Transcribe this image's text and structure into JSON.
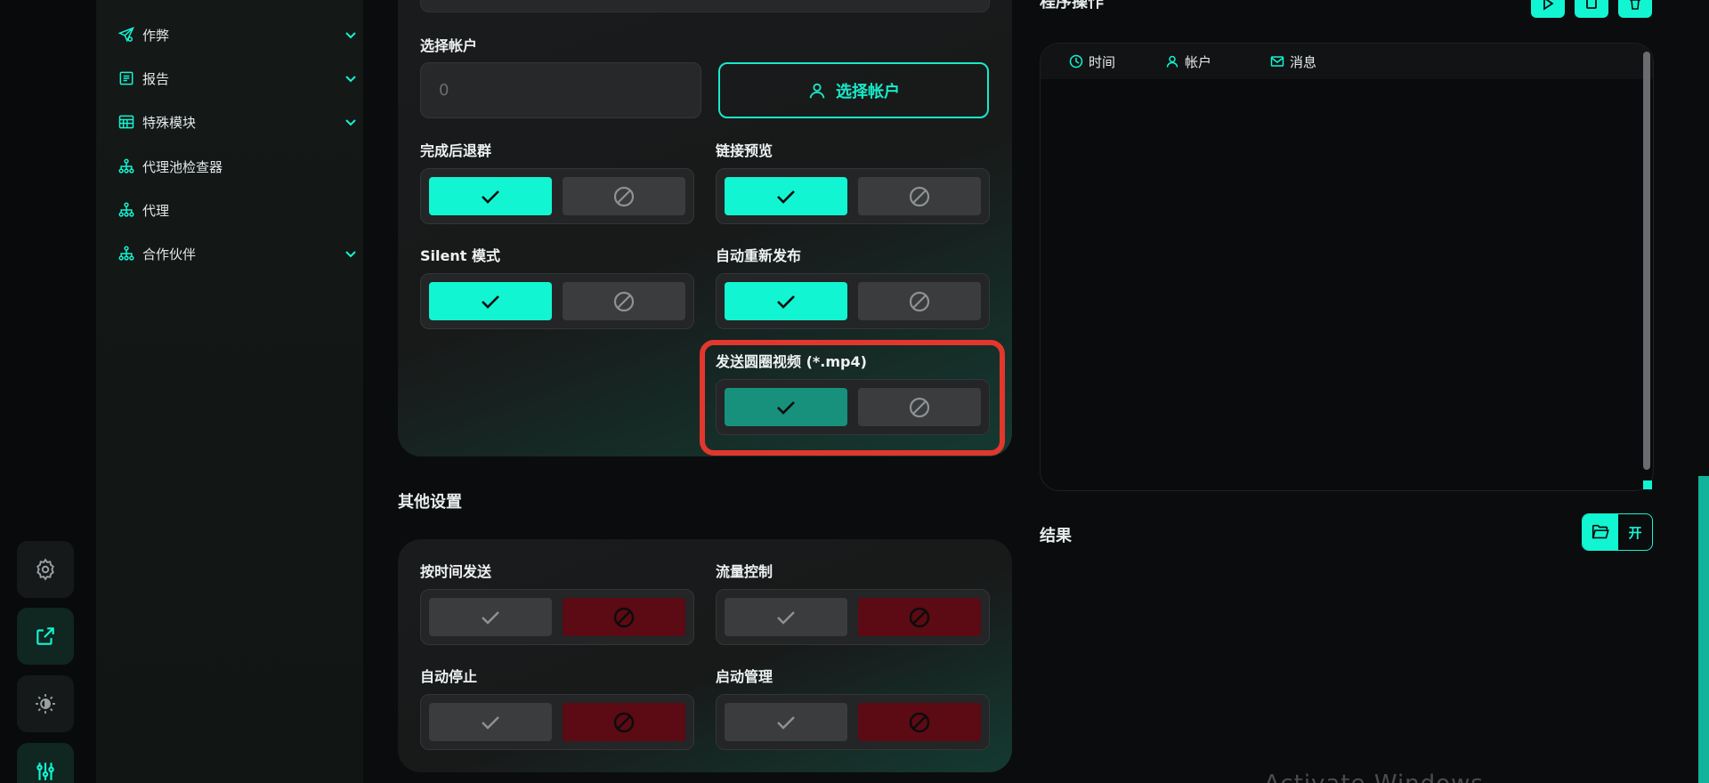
{
  "nav": {
    "items": [
      {
        "label": "作弊",
        "icon": "send-icon",
        "chevron": true
      },
      {
        "label": "报告",
        "icon": "report-icon",
        "chevron": true
      },
      {
        "label": "特殊模块",
        "icon": "module-icon",
        "chevron": true
      },
      {
        "label": "代理池检查器",
        "icon": "network-icon",
        "chevron": false
      },
      {
        "label": "代理",
        "icon": "network-icon",
        "chevron": false
      },
      {
        "label": "合作伙伴",
        "icon": "network-icon",
        "chevron": true
      }
    ]
  },
  "rail": {
    "items": [
      "gear-icon",
      "external-link-icon",
      "theme-icon",
      "sliders-icon"
    ]
  },
  "settings": {
    "account_label": "选择帐户",
    "account_value": "0",
    "select_account_button": "选择帐户",
    "toggles": [
      {
        "label": "完成后退群",
        "state": "on"
      },
      {
        "label": "链接预览",
        "state": "on"
      },
      {
        "label": "Silent 模式",
        "state": "on"
      },
      {
        "label": "自动重新发布",
        "state": "on"
      },
      {
        "label": "发送圆圈视频 (*.mp4)",
        "state": "on"
      }
    ]
  },
  "other_settings": {
    "title": "其他设置",
    "toggles": [
      {
        "label": "按时间发送",
        "state": "off"
      },
      {
        "label": "流量控制",
        "state": "off"
      },
      {
        "label": "自动停止",
        "state": "off"
      },
      {
        "label": "启动管理",
        "state": "off"
      }
    ]
  },
  "right": {
    "title": "程序操作",
    "log_columns": [
      {
        "label": "时间",
        "icon": "clock-icon"
      },
      {
        "label": "帐户",
        "icon": "user-icon"
      },
      {
        "label": "消息",
        "icon": "mail-icon"
      }
    ],
    "result_title": "结果",
    "open_label": "开"
  },
  "colors": {
    "accent": "#12f5d2",
    "accent_dim": "#17907c",
    "danger_dark": "#5c0a13",
    "highlight": "#e2372c"
  },
  "watermark": "Activate Windows"
}
